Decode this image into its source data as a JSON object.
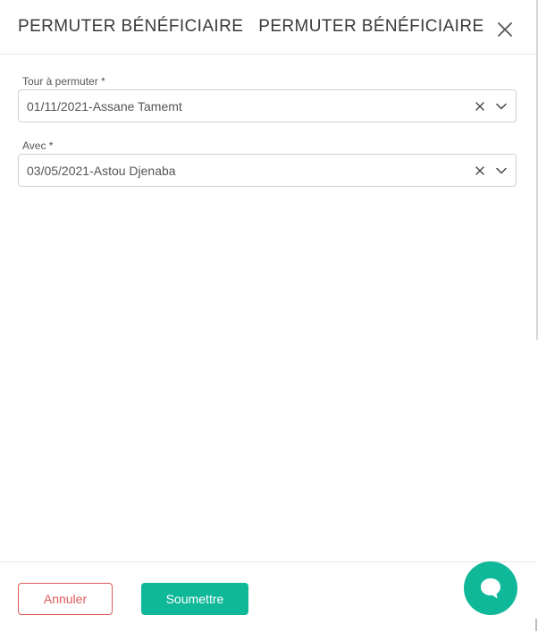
{
  "header": {
    "title_1": "PERMUTER BÉNÉFICIAIRE",
    "title_2": "PERMUTER BÉNÉFICIAIRE",
    "close_icon": "close-icon"
  },
  "form": {
    "tour": {
      "label": "Tour à permuter *",
      "value": "01/11/2021-Assane Tamemt"
    },
    "avec": {
      "label": "Avec *",
      "value": "03/05/2021-Astou Djenaba"
    }
  },
  "footer": {
    "cancel_label": "Annuler",
    "submit_label": "Soumettre"
  },
  "colors": {
    "accent": "#10b89a",
    "danger": "#e05a5a"
  },
  "icons": [
    "close-icon",
    "clear-icon",
    "chevron-down-icon",
    "chat-icon"
  ]
}
